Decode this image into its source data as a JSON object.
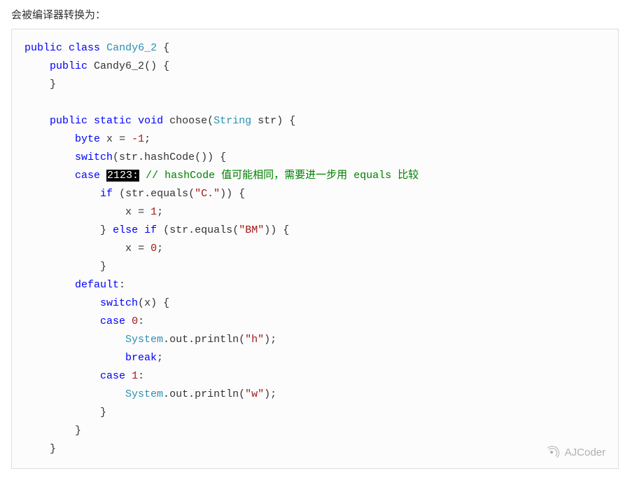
{
  "intro_text": "会被编译器转换为：",
  "watermark": "AJCoder",
  "code": {
    "class_name": "Candy6_2",
    "ctor_name": "Candy6_2",
    "method_name": "choose",
    "param_type": "String",
    "param_name": "str",
    "var_decl_type": "byte",
    "var_name": "x",
    "var_init": "-1",
    "hash_call": "hashCode",
    "case_value": "2123:",
    "comment": "// hashCode 值可能相同，需要进一步用 equals 比较",
    "equals1": "\"C.\"",
    "assign1": "1",
    "equals2": "\"BM\"",
    "assign0": "0",
    "switch2_var": "x",
    "case0": "0",
    "out_h": "\"h\"",
    "case1": "1",
    "out_w": "\"w\"",
    "kw_public": "public",
    "kw_class": "class",
    "kw_static": "static",
    "kw_void": "void",
    "kw_switch": "switch",
    "kw_case": "case",
    "kw_if": "if",
    "kw_else": "else",
    "kw_default": "default",
    "kw_break": "break",
    "sys": "System",
    "out": "out",
    "println": "println",
    "equals_m": "equals"
  }
}
